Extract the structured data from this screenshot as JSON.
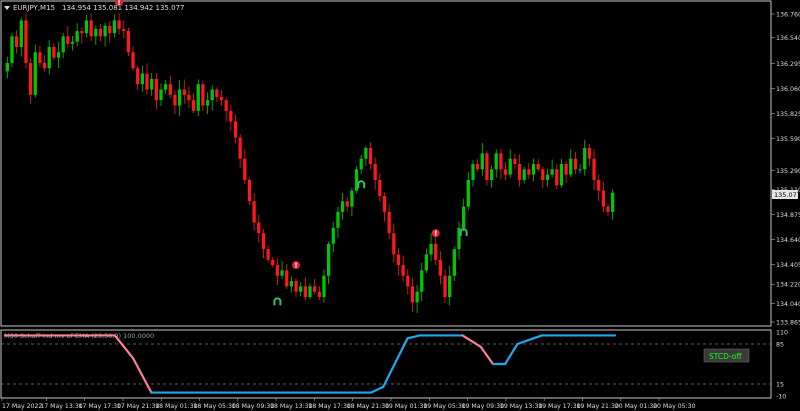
{
  "header": {
    "symbol": "EURJPY,M15",
    "ohlc": "134.954 135.081 134.942 135.077"
  },
  "main_axis": {
    "ticks": [
      "136.760",
      "136.540",
      "136.295",
      "136.060",
      "135.825",
      "135.590",
      "135.290",
      "135.110",
      "134.875",
      "134.640",
      "134.405",
      "134.220",
      "134.040",
      "133.865"
    ],
    "current_price": "135.077"
  },
  "indicator": {
    "title": "M30 Schaff ind mv of EMA (23,50,9) 100.0000",
    "ticks": [
      "110",
      "85",
      "15",
      "-10"
    ],
    "badge": "STCD-off"
  },
  "time_axis": {
    "labels": [
      "17 May 2022",
      "17 May 13:30",
      "17 May 17:30",
      "17 May 21:30",
      "18 May 01:30",
      "18 May 05:30",
      "18 May 09:30",
      "18 May 13:30",
      "18 May 17:30",
      "18 May 21:30",
      "19 May 01:30",
      "19 May 05:30",
      "19 May 09:30",
      "19 May 13:30",
      "19 May 17:30",
      "19 May 21:30",
      "20 May 01:30",
      "20 May 05:30"
    ]
  },
  "signals": [
    {
      "kind": "sell",
      "glyph": "!",
      "index": 24
    },
    {
      "kind": "buy",
      "glyph": "∩",
      "index": 58
    },
    {
      "kind": "sell",
      "glyph": "!",
      "index": 62
    },
    {
      "kind": "buy",
      "glyph": "∩",
      "index": 76
    },
    {
      "kind": "sell",
      "glyph": "!",
      "index": 92
    },
    {
      "kind": "buy",
      "glyph": "∩",
      "index": 98
    }
  ],
  "colors": {
    "background": "#000000",
    "bull_candle": "#00c800",
    "bear_candle": "#ff1a1a",
    "text": "#dddddd",
    "stc_up": "#1fa8f0",
    "stc_down": "#ff7f93",
    "sell_marker": "#e8203a",
    "buy_marker": "#30c070",
    "badge_bg": "#3a3a3a",
    "badge_text": "#19ff19"
  },
  "chart_data": {
    "type": "candlestick",
    "y_range": [
      133.865,
      136.76
    ],
    "closes": [
      136.3,
      136.55,
      136.45,
      136.7,
      136.3,
      136.0,
      136.4,
      136.3,
      136.25,
      136.45,
      136.35,
      136.4,
      136.55,
      136.48,
      136.5,
      136.6,
      136.58,
      136.7,
      136.55,
      136.62,
      136.55,
      136.65,
      136.58,
      136.7,
      136.62,
      136.6,
      136.4,
      136.25,
      136.1,
      136.2,
      136.05,
      136.15,
      135.95,
      136.05,
      136.1,
      136.0,
      135.9,
      136.05,
      136.0,
      135.95,
      135.85,
      136.1,
      135.9,
      135.95,
      136.05,
      135.98,
      135.95,
      135.85,
      135.75,
      135.6,
      135.4,
      135.2,
      135.0,
      134.8,
      134.7,
      134.55,
      134.45,
      134.4,
      134.3,
      134.35,
      134.2,
      134.25,
      134.15,
      134.2,
      134.1,
      134.2,
      134.15,
      134.1,
      134.3,
      134.6,
      134.75,
      134.9,
      135.0,
      134.95,
      135.1,
      135.3,
      135.4,
      135.5,
      135.35,
      135.2,
      135.05,
      134.9,
      134.7,
      134.5,
      134.4,
      134.3,
      134.2,
      134.05,
      134.15,
      134.35,
      134.5,
      134.6,
      134.45,
      134.3,
      134.1,
      134.3,
      134.55,
      134.75,
      134.95,
      135.2,
      135.35,
      135.3,
      135.45,
      135.2,
      135.3,
      135.45,
      135.3,
      135.25,
      135.4,
      135.35,
      135.2,
      135.3,
      135.25,
      135.35,
      135.3,
      135.2,
      135.25,
      135.3,
      135.15,
      135.35,
      135.25,
      135.4,
      135.3,
      135.3,
      135.5,
      135.4,
      135.2,
      135.1,
      134.95,
      134.9,
      135.08
    ],
    "stc": {
      "ylim": [
        -10,
        110
      ],
      "x": [
        0,
        0.18,
        0.21,
        0.24,
        0.6,
        0.62,
        0.66,
        0.68,
        0.75,
        0.78,
        0.8,
        0.82,
        0.84,
        0.88,
        1.0
      ],
      "y": [
        100,
        100,
        60,
        0,
        0,
        10,
        95,
        100,
        100,
        80,
        50,
        50,
        85,
        100,
        100
      ]
    }
  }
}
